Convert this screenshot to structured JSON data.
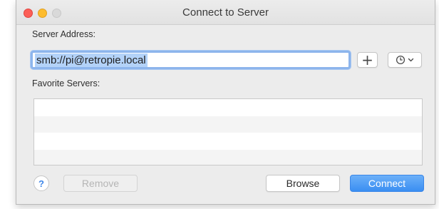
{
  "window": {
    "title": "Connect to Server"
  },
  "server_address": {
    "label": "Server Address:",
    "value": "smb://pi@retropie.local"
  },
  "toolbar": {
    "add_icon": "plus-icon",
    "recent_icon": "clock-icon",
    "recent_dropdown_icon": "chevron-down-icon"
  },
  "favorites": {
    "label": "Favorite Servers:",
    "items": []
  },
  "buttons": {
    "help": "?",
    "remove": "Remove",
    "browse": "Browse",
    "connect": "Connect"
  },
  "colors": {
    "accent": "#3a8ef2",
    "close": "#fc5f57",
    "minimize": "#fdbc2e",
    "zoom_inactive": "#d9d9d9"
  }
}
